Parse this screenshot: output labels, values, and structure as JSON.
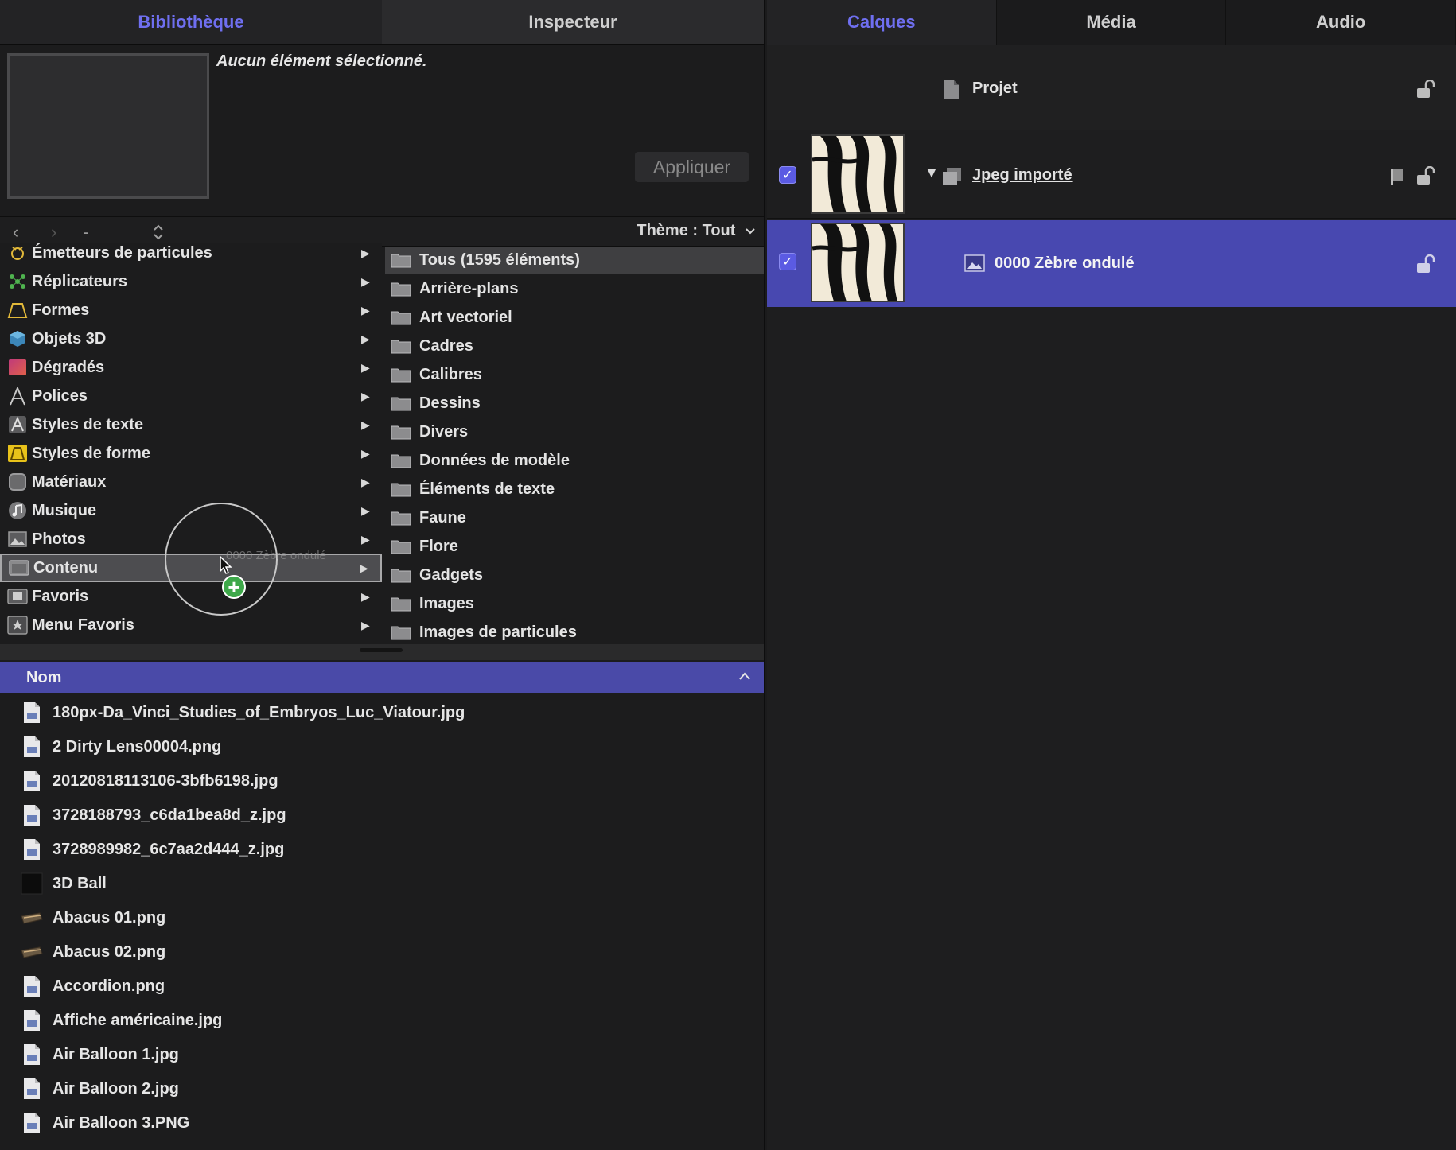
{
  "left": {
    "tabs": [
      {
        "label": "Bibliothèque"
      },
      {
        "label": "Inspecteur"
      }
    ],
    "preview": {
      "message": "Aucun élément sélectionné.",
      "apply_label": "Appliquer"
    },
    "navbar": {
      "back": "‹",
      "forward": "›",
      "minus": "-",
      "updown": "⌃",
      "theme_label": "Thème : Tout",
      "theme_arrow": "⌄"
    },
    "categories": [
      {
        "label": "Émetteurs de particules",
        "icon": "emitter-icon"
      },
      {
        "label": "Réplicateurs",
        "icon": "replicator-icon"
      },
      {
        "label": "Formes",
        "icon": "shape-icon"
      },
      {
        "label": "Objets 3D",
        "icon": "3d-object-icon"
      },
      {
        "label": "Dégradés",
        "icon": "gradient-icon"
      },
      {
        "label": "Polices",
        "icon": "font-icon"
      },
      {
        "label": "Styles de texte",
        "icon": "text-style-icon"
      },
      {
        "label": "Styles de forme",
        "icon": "shape-style-icon"
      },
      {
        "label": "Matériaux",
        "icon": "material-icon"
      },
      {
        "label": "Musique",
        "icon": "music-icon"
      },
      {
        "label": "Photos",
        "icon": "photos-icon"
      },
      {
        "label": "Contenu",
        "icon": "content-icon"
      },
      {
        "label": "Favoris",
        "icon": "favorites-icon"
      },
      {
        "label": "Menu Favoris",
        "icon": "favorites-menu-icon"
      }
    ],
    "selected_category": "Contenu",
    "folders": [
      "Tous (1595 éléments)",
      "Arrière-plans",
      "Art vectoriel",
      "Cadres",
      "Calibres",
      "Dessins",
      "Divers",
      "Données de modèle",
      "Éléments de texte",
      "Faune",
      "Flore",
      "Gadgets",
      "Images",
      "Images de particules"
    ],
    "file_header": "Nom",
    "files": [
      {
        "name": "180px-Da_Vinci_Studies_of_Embryos_Luc_Viatour.jpg",
        "icon": "image-file-icon"
      },
      {
        "name": "2 Dirty Lens00004.png",
        "icon": "image-file-icon"
      },
      {
        "name": "20120818113106-3bfb6198.jpg",
        "icon": "image-file-icon"
      },
      {
        "name": "3728188793_c6da1bea8d_z.jpg",
        "icon": "image-file-icon"
      },
      {
        "name": "3728989982_6c7aa2d444_z.jpg",
        "icon": "image-file-icon"
      },
      {
        "name": "3D Ball",
        "icon": "3d-ball-icon"
      },
      {
        "name": "Abacus 01.png",
        "icon": "abacus-icon"
      },
      {
        "name": "Abacus 02.png",
        "icon": "abacus-icon"
      },
      {
        "name": "Accordion.png",
        "icon": "image-file-icon"
      },
      {
        "name": "Affiche américaine.jpg",
        "icon": "image-file-icon"
      },
      {
        "name": "Air Balloon 1.jpg",
        "icon": "image-file-icon"
      },
      {
        "name": "Air Balloon 2.jpg",
        "icon": "image-file-icon"
      },
      {
        "name": "Air Balloon 3.PNG",
        "icon": "image-file-icon"
      }
    ],
    "drag_ghost_label": "0000 Zèbre ondulé",
    "drag_plus": "+"
  },
  "right": {
    "tabs": [
      {
        "label": "Calques"
      },
      {
        "label": "Média"
      },
      {
        "label": "Audio"
      }
    ],
    "layers": {
      "project": "Projet",
      "group": "Jpeg importé",
      "group_disclosure": "▼",
      "item": "0000 Zèbre ondulé"
    },
    "check_mark": "✓"
  },
  "colors": {
    "accent": "#5b5be3",
    "selection": "#4848b0",
    "header": "#4a4aa8",
    "background": "#1c1c1d"
  }
}
